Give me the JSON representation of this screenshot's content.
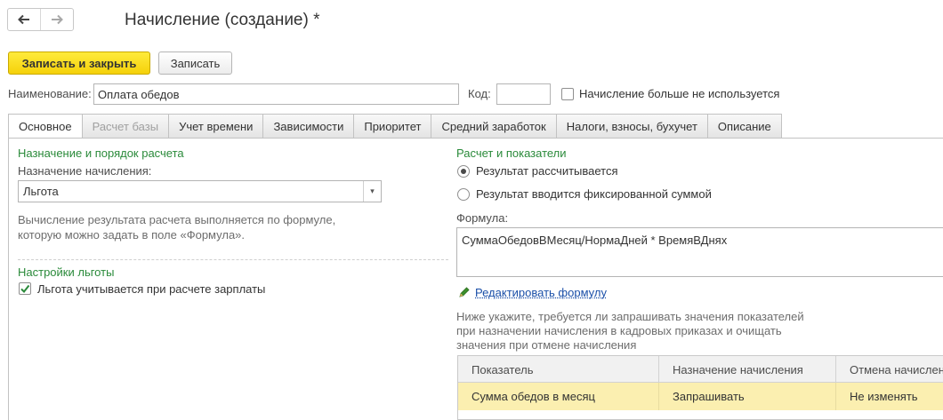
{
  "window": {
    "title": "Начисление (создание) *"
  },
  "nav": {
    "back_icon": "arrow-left-icon",
    "forward_icon": "arrow-right-icon"
  },
  "toolbar": {
    "save_close_label": "Записать и закрыть",
    "save_label": "Записать"
  },
  "form": {
    "name_label": "Наименование:",
    "name_value": "Оплата обедов",
    "code_label": "Код:",
    "code_value": "",
    "unused_label": "Начисление больше не используется",
    "unused_checked": false
  },
  "tabs": [
    {
      "label": "Основное",
      "state": "active"
    },
    {
      "label": "Расчет базы",
      "state": "disabled"
    },
    {
      "label": "Учет времени",
      "state": "normal"
    },
    {
      "label": "Зависимости",
      "state": "normal"
    },
    {
      "label": "Приоритет",
      "state": "normal"
    },
    {
      "label": "Средний заработок",
      "state": "normal"
    },
    {
      "label": "Налоги, взносы, бухучет",
      "state": "normal"
    },
    {
      "label": "Описание",
      "state": "normal"
    }
  ],
  "left": {
    "group_title": "Назначение и порядок расчета",
    "purpose_label": "Назначение начисления:",
    "purpose_value": "Льгота",
    "hint_line1": "Вычисление результата расчета выполняется по формуле,",
    "hint_line2": "которую можно задать в поле «Формула».",
    "benefit_group_title": "Настройки льготы",
    "benefit_checkbox_label": "Льгота учитывается при расчете зарплаты",
    "benefit_checked": true
  },
  "right": {
    "group_title": "Расчет и показатели",
    "radio_calculated_label": "Результат рассчитывается",
    "radio_fixed_label": "Результат вводится фиксированной суммой",
    "selected_radio": "calculated",
    "formula_label": "Формула:",
    "formula_value": "СуммаОбедовВМесяц/НормаДней * ВремяВДнях",
    "edit_formula_link": "Редактировать формулу",
    "edit_icon": "pencil-icon",
    "indicators_hint_line1": "Ниже укажите, требуется ли запрашивать значения показателей",
    "indicators_hint_line2": "при назначении начисления в кадровых приказах и очищать",
    "indicators_hint_line3": "значения при отмене начисления"
  },
  "indicators_table": {
    "columns": [
      "Показатель",
      "Назначение начисления",
      "Отмена начисления"
    ],
    "rows": [
      [
        "Сумма обедов в месяц",
        "Запрашивать",
        "Не изменять"
      ]
    ]
  },
  "colors": {
    "primary_button": "#f5d10a",
    "group_title": "#2a8a3a",
    "link": "#1a4fa8",
    "selected_row": "#fbefb0"
  }
}
